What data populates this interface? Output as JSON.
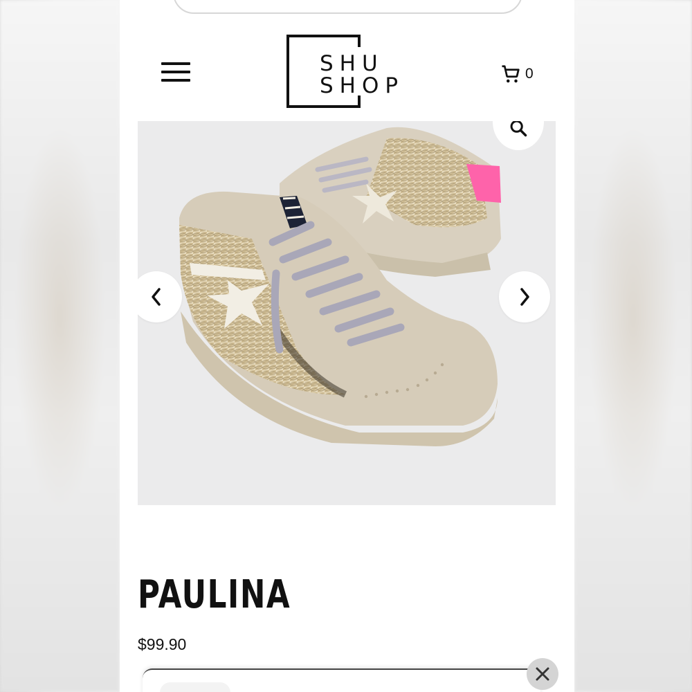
{
  "header": {
    "logo_line1": "SHU",
    "logo_line2": "SHOP",
    "cart_count": "0"
  },
  "icons": {
    "menu": "hamburger-menu-icon",
    "cart": "shopping-cart-icon",
    "zoom": "magnifier-icon",
    "prev": "chevron-left-icon",
    "next": "chevron-right-icon",
    "close": "close-icon"
  },
  "product": {
    "title": "PAULINA",
    "price": "$99.90",
    "image_description": "metallic snake-print high-top sneakers with star patch and pink heel tab"
  },
  "colors": {
    "gallery_bg": "#ebebec",
    "accent_pink": "#ff5fa8",
    "text": "#111111"
  }
}
